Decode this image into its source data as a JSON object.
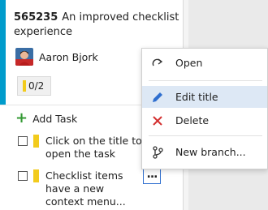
{
  "card": {
    "id": "565235",
    "title": "An improved checklist experience",
    "assignee": "Aaron Bjork",
    "checklist_progress": "0/2",
    "accent_color": "#009ccc"
  },
  "tasks": {
    "add_label": "Add Task",
    "items": [
      {
        "text": "Click on the title to open the task",
        "checked": false
      },
      {
        "text": "Checklist items have a new context menu...",
        "checked": false
      }
    ],
    "more_label": "..."
  },
  "context_menu": {
    "items": [
      {
        "label": "Open",
        "icon": "open-arrow-icon"
      },
      {
        "label": "Edit title",
        "icon": "pencil-icon",
        "highlighted": true
      },
      {
        "label": "Delete",
        "icon": "close-x-icon"
      },
      {
        "label": "New branch...",
        "icon": "branch-icon"
      }
    ]
  }
}
